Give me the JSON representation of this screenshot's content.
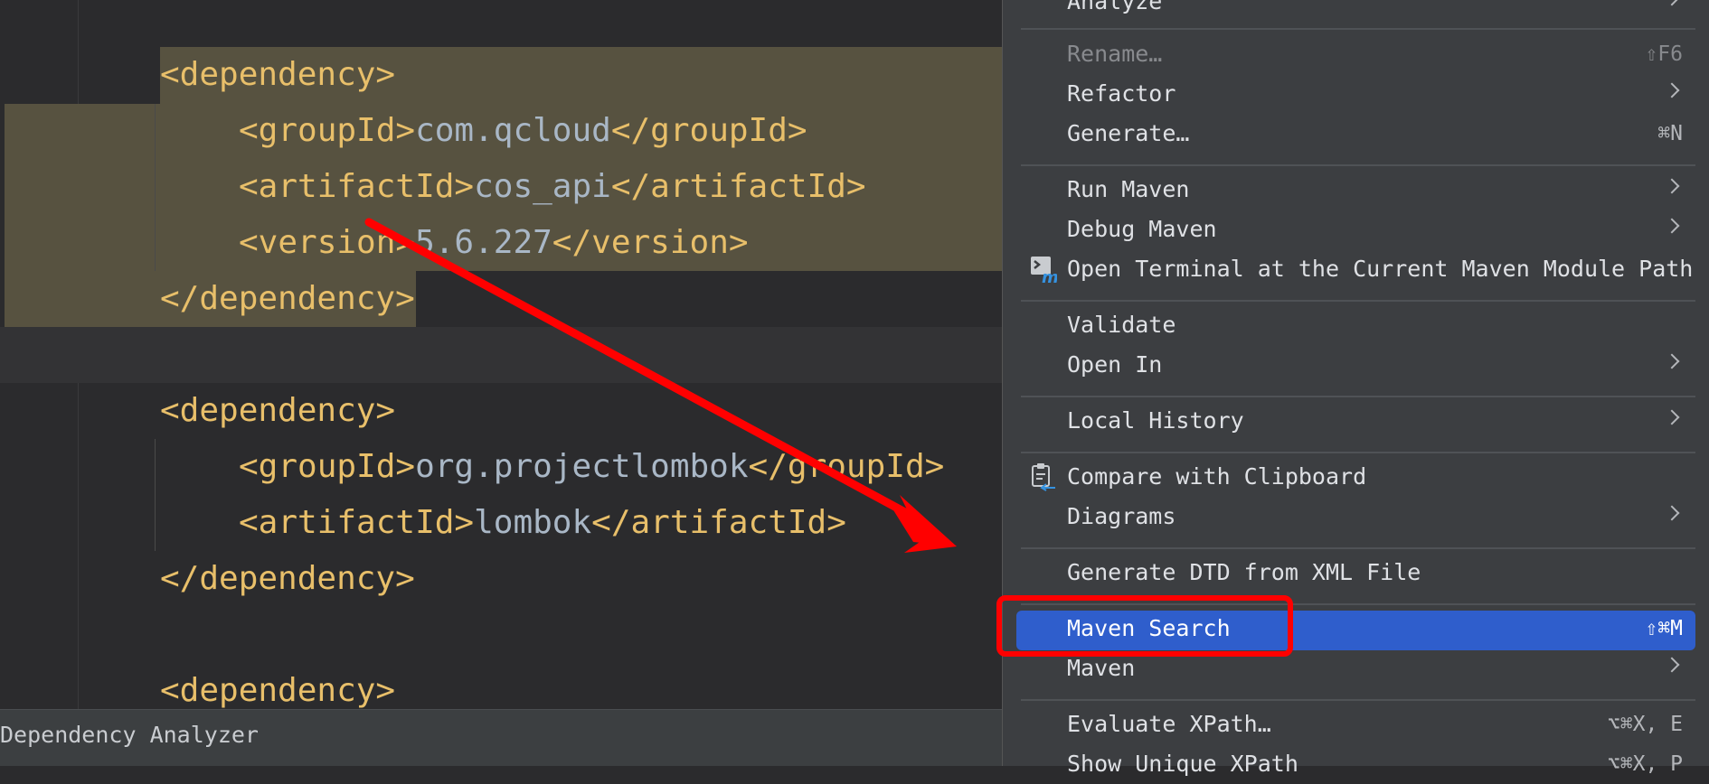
{
  "editor": {
    "lines": [
      {
        "tag_open": "<dependency>",
        "text": "",
        "tag_close": ""
      },
      {
        "tag_open": "<groupId>",
        "text": "com.qcloud",
        "tag_close": "</groupId>"
      },
      {
        "tag_open": "<artifactId>",
        "text": "cos_api",
        "tag_close": "</artifactId>"
      },
      {
        "tag_open": "<version>",
        "text": "5.6.227",
        "tag_close": "</version>"
      },
      {
        "tag_open": "</dependency>",
        "text": "",
        "tag_close": ""
      },
      {
        "tag_open": "<dependency>",
        "text": "",
        "tag_close": ""
      },
      {
        "tag_open": "<groupId>",
        "text": "org.projectlombok",
        "tag_close": "</groupId>"
      },
      {
        "tag_open": "<artifactId>",
        "text": "lombok",
        "tag_close": "</artifactId>"
      },
      {
        "tag_open": "</dependency>",
        "text": "",
        "tag_close": ""
      },
      {
        "tag_open": "<dependency>",
        "text": "",
        "tag_close": ""
      }
    ]
  },
  "statusbar": {
    "label": "Dependency Analyzer"
  },
  "menu": {
    "items": [
      {
        "label": "Analyze",
        "shortcut": "",
        "submenu": true
      },
      {
        "label": "Rename…",
        "shortcut": "⇧F6",
        "disabled": true
      },
      {
        "label": "Refactor",
        "shortcut": "",
        "submenu": true
      },
      {
        "label": "Generate…",
        "shortcut": "⌘N"
      },
      {
        "label": "Run Maven",
        "shortcut": "",
        "submenu": true
      },
      {
        "label": "Debug Maven",
        "shortcut": "",
        "submenu": true
      },
      {
        "label": "Open Terminal at the Current Maven Module Path",
        "shortcut": "",
        "icon": "maven-terminal-icon"
      },
      {
        "label": "Validate",
        "shortcut": ""
      },
      {
        "label": "Open In",
        "shortcut": "",
        "submenu": true
      },
      {
        "label": "Local History",
        "shortcut": "",
        "submenu": true
      },
      {
        "label": "Compare with Clipboard",
        "shortcut": "",
        "icon": "clipboard-compare-icon"
      },
      {
        "label": "Diagrams",
        "shortcut": "",
        "submenu": true
      },
      {
        "label": "Generate DTD from XML File",
        "shortcut": ""
      },
      {
        "label": "Maven Search",
        "shortcut": "⇧⌘M",
        "selected": true
      },
      {
        "label": "Maven",
        "shortcut": "",
        "submenu": true
      },
      {
        "label": "Evaluate XPath…",
        "shortcut": "⌥⌘X, E"
      },
      {
        "label": "Show Unique XPath",
        "shortcut": "⌥⌘X, P"
      }
    ]
  },
  "colors": {
    "tag": "#e8bf6a",
    "text": "#a9b7c6",
    "highlight": "#575240",
    "selection": "#2f5ecc",
    "annotation": "#ff0000"
  }
}
